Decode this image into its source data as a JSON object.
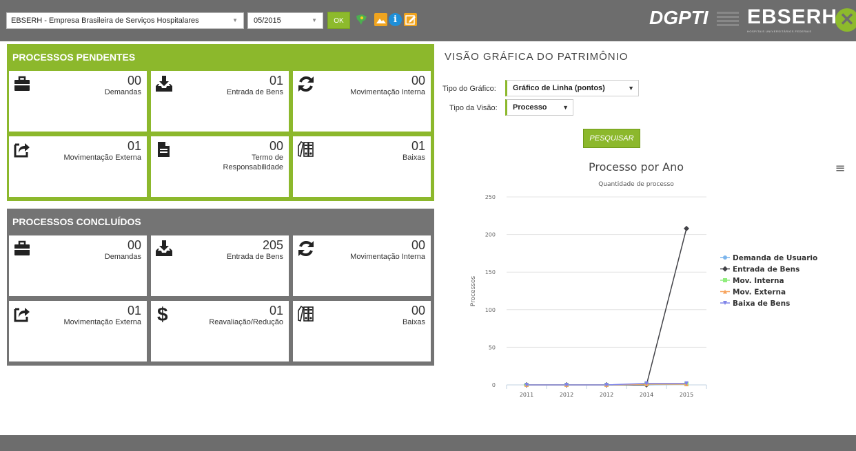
{
  "topbar": {
    "org_select": "EBSERH - Empresa Brasileira de Serviços Hospitalares",
    "period_select": "05/2015",
    "ok_label": "OK",
    "info_glyph": "i",
    "logo_dgpti": "DGPTI",
    "logo_ebserh": "EBSERH",
    "logo_ebserh_tagline": "HOSPITAIS UNIVERSITÁRIOS FEDERAIS"
  },
  "pending": {
    "title": "PROCESSOS PENDENTES",
    "tiles": [
      {
        "count": "00",
        "label": "Demandas",
        "icon": "briefcase-icon"
      },
      {
        "count": "01",
        "label": "Entrada de Bens",
        "icon": "inbox-download-icon"
      },
      {
        "count": "00",
        "label": "Movimentação Interna",
        "icon": "refresh-icon"
      },
      {
        "count": "01",
        "label": "Movimentação Externa",
        "icon": "share-external-icon"
      },
      {
        "count": "00",
        "label": "Termo de Responsabilidade",
        "icon": "document-icon"
      },
      {
        "count": "01",
        "label": "Baixas",
        "icon": "binders-icon"
      }
    ]
  },
  "done": {
    "title": "PROCESSOS CONCLUÍDOS",
    "tiles": [
      {
        "count": "00",
        "label": "Demandas",
        "icon": "briefcase-icon"
      },
      {
        "count": "205",
        "label": "Entrada de Bens",
        "icon": "inbox-download-icon"
      },
      {
        "count": "00",
        "label": "Movimentação Interna",
        "icon": "refresh-icon"
      },
      {
        "count": "01",
        "label": "Movimentação Externa",
        "icon": "share-external-icon"
      },
      {
        "count": "01",
        "label": "Reavaliação/Redução",
        "icon": "dollar-icon"
      },
      {
        "count": "00",
        "label": "Baixas",
        "icon": "binders-icon"
      }
    ]
  },
  "viz": {
    "title": "VISÃO GRÁFICA DO PATRIMÔNIO",
    "chart_type_label": "Tipo do Gráfico:",
    "chart_type_value": "Gráfico de Linha (pontos)",
    "view_type_label": "Tipo da Visão:",
    "view_type_value": "Processo",
    "search_label": "PESQUISAR",
    "menu_glyph": "≡"
  },
  "chart_data": {
    "type": "line",
    "title": "Processo por Ano",
    "subtitle": "Quantidade de processo",
    "xlabel": "",
    "ylabel": "Processos",
    "categories": [
      "2011",
      "2012",
      "2012",
      "2014",
      "2015"
    ],
    "yticks": [
      0,
      50,
      100,
      150,
      200,
      250
    ],
    "ylim": [
      0,
      250
    ],
    "grid": true,
    "legend_position": "right",
    "series": [
      {
        "name": "Demanda de Usuario",
        "color": "#7cb5ec",
        "marker": "circle",
        "values": [
          0,
          0,
          0,
          0,
          1
        ]
      },
      {
        "name": "Entrada de Bens",
        "color": "#434348",
        "marker": "diamond",
        "values": [
          0,
          0,
          0,
          0,
          208
        ]
      },
      {
        "name": "Mov. Interna",
        "color": "#90ed7d",
        "marker": "square",
        "values": [
          0,
          0,
          0,
          1,
          1
        ]
      },
      {
        "name": "Mov. Externa",
        "color": "#f7a35c",
        "marker": "triangle",
        "values": [
          0,
          0,
          0,
          1,
          1
        ]
      },
      {
        "name": "Baixa de Bens",
        "color": "#8085e9",
        "marker": "triangle-down",
        "values": [
          0,
          0,
          0,
          2,
          2
        ]
      }
    ]
  }
}
